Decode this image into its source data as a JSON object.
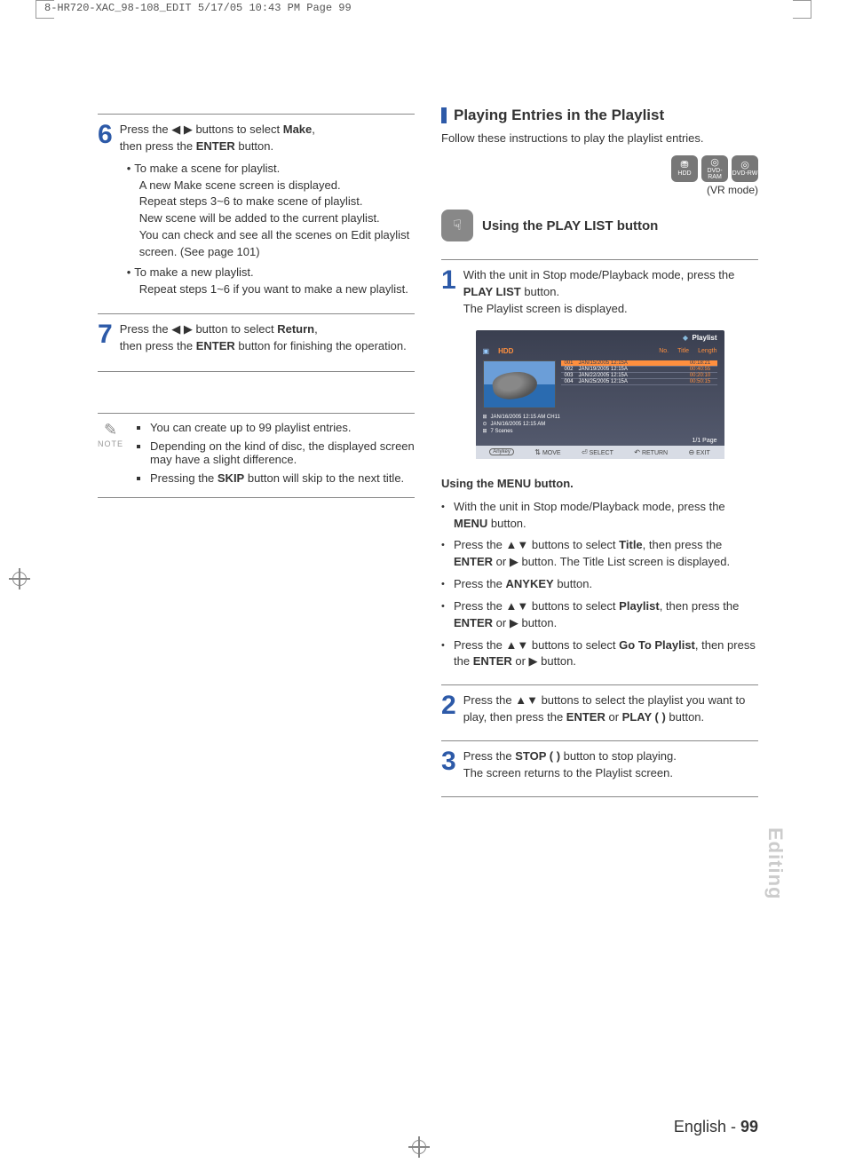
{
  "crop_header": "8-HR720-XAC_98-108_EDIT  5/17/05  10:43 PM  Page 99",
  "left": {
    "step6": {
      "num": "6",
      "line1_a": "Press the ",
      "line1_b": " buttons to select ",
      "line1_bold": "Make",
      "line2_a": "then press the ",
      "line2_bold": "ENTER",
      "line2_b": " button.",
      "b1": "To make a scene for playlist.",
      "b1a": "A new Make scene screen is displayed.",
      "b1b": "Repeat steps 3~6 to make scene of playlist.",
      "b1c": "New scene will be added to the current playlist.",
      "b1d": "You can check and see all the scenes on Edit playlist screen. (See page 101)",
      "b2": "To make a new playlist.",
      "b2a": "Repeat steps 1~6 if you want to make a new playlist."
    },
    "step7": {
      "num": "7",
      "line1_a": "Press the ",
      "line1_b": " button to select ",
      "line1_bold": "Return",
      "line2_a": "then press the ",
      "line2_bold": "ENTER",
      "line2_b": " button for finishing the operation."
    },
    "note_label": "NOTE",
    "notes": {
      "n1": "You can create up to 99 playlist entries.",
      "n2": "Depending on the kind of disc, the displayed screen may have a slight difference.",
      "n3_a": "Pressing the ",
      "n3_bold": "SKIP",
      "n3_b": " button will skip to the next title."
    }
  },
  "right": {
    "section_title": "Playing Entries in the Playlist",
    "section_sub": "Follow these instructions to play the playlist entries.",
    "media": {
      "hdd": "HDD",
      "ram": "DVD-RAM",
      "rw": "DVD-RW"
    },
    "mode_label": "(VR mode)",
    "sub_section": "Using the PLAY LIST button",
    "step1": {
      "num": "1",
      "l1_a": "With the unit in Stop mode/Playback mode, press the ",
      "l1_bold": "PLAY LIST",
      "l1_b": " button.",
      "l2": "The Playlist screen is displayed."
    },
    "screen": {
      "header_label": "Playlist",
      "source": "HDD",
      "cols": {
        "no": "No.",
        "title": "Title",
        "length": "Length"
      },
      "rows": [
        {
          "no": "001",
          "title": "JAN/15/2005 12:15A",
          "len": "00:18:21"
        },
        {
          "no": "002",
          "title": "JAN/19/2005 12:15A",
          "len": "00:40:55"
        },
        {
          "no": "003",
          "title": "JAN/22/2005 12:15A",
          "len": "00:20:10"
        },
        {
          "no": "004",
          "title": "JAN/25/2005 12:15A",
          "len": "00:50:15"
        }
      ],
      "info1": "JAN/16/2005 12:15 AM CH11",
      "info2": "JAN/16/2005 12:15 AM",
      "info3": "7 Scenes",
      "page": "1/1  Page",
      "footer": {
        "move": "MOVE",
        "select": "SELECT",
        "ret": "RETURN",
        "exit": "EXIT"
      }
    },
    "menu_title": "Using the MENU button.",
    "menu": {
      "m1_a": "With the unit in Stop mode/Playback mode, press the ",
      "m1_bold": "MENU",
      "m1_b": " button.",
      "m2_a": "Press the ",
      "m2_b": " buttons to select ",
      "m2_bold": "Title",
      "m2_c": ", then press the ",
      "m2_bold2": "ENTER",
      "m2_d": " or ",
      "m2_e": " button. The Title List screen is displayed.",
      "m3_a": "Press the ",
      "m3_bold": "ANYKEY",
      "m3_b": " button.",
      "m4_a": "Press the ",
      "m4_b": " buttons to select ",
      "m4_bold": "Playlist",
      "m4_c": ", then press the ",
      "m4_bold2": "ENTER",
      "m4_d": " or ",
      "m4_e": " button.",
      "m5_a": "Press the ",
      "m5_b": " buttons to select ",
      "m5_bold": "Go To Playlist",
      "m5_c": ", then press the ",
      "m5_bold2": "ENTER",
      "m5_d": " or ",
      "m5_e": " button."
    },
    "step2": {
      "num": "2",
      "l1_a": "Press the ",
      "l1_b": " buttons to select the playlist you want to play, then press the ",
      "l1_bold": "ENTER",
      "l1_c": " or ",
      "l1_bold2": "PLAY (    )",
      "l1_d": " button."
    },
    "step3": {
      "num": "3",
      "l1_a": "Press the ",
      "l1_bold": "STOP (    )",
      "l1_b": "  button to stop playing.",
      "l2": "The screen returns to the Playlist screen."
    }
  },
  "side_tab": "Editing",
  "footer": {
    "lang": "English ",
    "sep": "- ",
    "page": "99"
  }
}
